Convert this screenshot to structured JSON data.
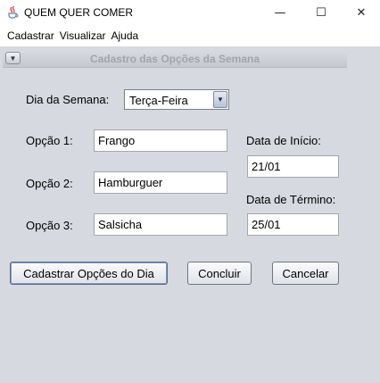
{
  "window": {
    "title": "QUEM QUER COMER",
    "controls": {
      "minimize": "—",
      "maximize": "☐",
      "close": "✕"
    }
  },
  "menubar": {
    "items": [
      "Cadastrar",
      "Visualizar",
      "Ajuda"
    ]
  },
  "frame": {
    "title": "Cadastro das Opções da Semana",
    "toggle_glyph": "▼"
  },
  "form": {
    "day_label": "Dia da Semana:",
    "day_value": "Terça-Feira",
    "option1_label": "Opção 1:",
    "option1_value": "Frango",
    "option2_label": "Opção 2:",
    "option2_value": "Hamburguer",
    "option3_label": "Opção 3:",
    "option3_value": "Salsicha",
    "start_label": "Data de Início:",
    "start_value": "21/01",
    "end_label": "Data de Término:",
    "end_value": "25/01"
  },
  "buttons": {
    "register": "Cadastrar Opções do Dia",
    "finish": "Concluir",
    "cancel": "Cancelar"
  },
  "icons": {
    "app": "java-coffee-icon",
    "combo_arrow": "chevron-down-icon"
  }
}
